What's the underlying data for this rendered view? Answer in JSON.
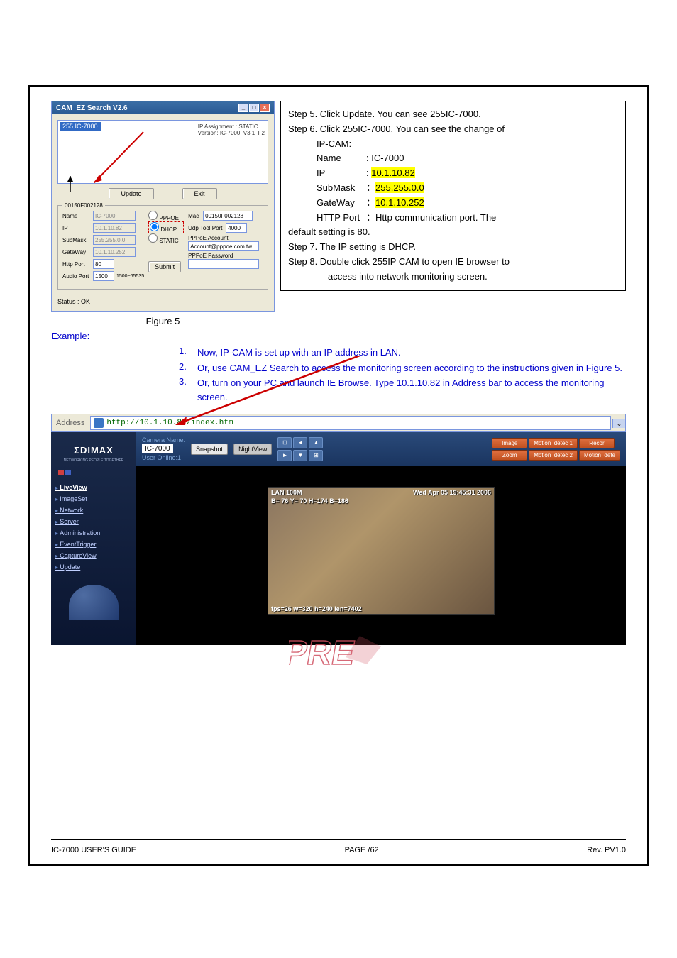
{
  "steps": {
    "s5": "Step 5. Click Update. You can see 255IC-7000.",
    "s6": "Step 6. Click 255IC-7000. You can see the change of",
    "s6b": "IP-CAM:",
    "name_lbl": "Name",
    "name_val": ": IC-7000",
    "ip_lbl": "IP",
    "ip_colon": ": ",
    "ip_val": "10.1.10.82",
    "sub_lbl": "SubMask",
    "sub_colon": "：",
    "sub_val": "255.255.0.0",
    "gw_lbl": "GateWay",
    "gw_colon": "：",
    "gw_val": "10.1.10.252",
    "http_lbl": "HTTP Port",
    "http_val": "：Http communication port. The",
    "default": "default setting is 80.",
    "s7": "Step 7. The IP setting is DHCP.",
    "s8": "Step 8. Double click 255IP CAM to open IE browser to",
    "s8b": "access into network monitoring screen."
  },
  "dialog": {
    "title": "CAM_EZ Search V2.6",
    "sel": "255 IC-7000",
    "ipassign": "IP Assignment : STATIC",
    "version": "Version: IC-7000_V3.1_F2",
    "update": "Update",
    "exit": "Exit",
    "legend": "00150F002128",
    "name": "Name",
    "name_v": "IC-7000",
    "ip": "IP",
    "ip_v": "10.1.10.82",
    "submask": "SubMask",
    "submask_v": "255.255.0.0",
    "gateway": "GateWay",
    "gateway_v": "10.1.10.252",
    "httpport": "Http Port",
    "httpport_v": "80",
    "audioport": "Audio Port",
    "audioport_v": "1500",
    "audioport_range": "1500~65535",
    "pppoe": "PPPOE",
    "dhcp": "DHCP",
    "static": "STATIC",
    "mac": "Mac",
    "mac_v": "00150F002128",
    "udp": "Udp Tool Port",
    "udp_v": "4000",
    "pppoe_acc": "PPPoE Account",
    "pppoe_acc_v": "Account@pppoe.com.tw",
    "pppoe_pwd": "PPPoE Password",
    "submit": "Submit",
    "status": "Status :    OK"
  },
  "figure": "Figure 5",
  "example_label": "Example:",
  "examples": {
    "n1": "1.",
    "t1": "Now, IP-CAM is set up with an IP address in LAN.",
    "n2": "2.",
    "t2": "Or, use CAM_EZ Search to access the monitoring screen according to the instructions given in Figure 5.",
    "n3": "3.",
    "t3": "Or, turn on your PC and launch IE Browse. Type 10.1.10.82 in Address bar to access the monitoring screen."
  },
  "browser": {
    "addr_lbl": "Address",
    "url": "http://10.1.10.82/index.htm",
    "logo": "ΣDIMAX",
    "logosub": "NETWORKING PEOPLE TOGETHER",
    "cam_name_lbl": "Camera Name:",
    "cam_name": "IC-7000",
    "user_online": "User Online:1",
    "snapshot": "Snapshot",
    "nightview": "NightView",
    "nav": {
      "liveview": "LiveView",
      "imageset": "ImageSet",
      "network": "Network",
      "server": "Server",
      "admin": "Administration",
      "event": "EventTrigger",
      "capture": "CaptureView",
      "update": "Update"
    },
    "rbtn": {
      "image": "Image",
      "zoom": "Zoom",
      "md1": "Motion_detec 1",
      "md2": "Motion_detec 2",
      "recor": "Recor",
      "mdete": "Motion_dete"
    },
    "overlay": {
      "lan": "LAN 100M",
      "date": "Wed Apr 05 19:45:31 2006",
      "coords": "B= 76 Y= 70 H=174 B=186",
      "fps": "fps=26 w=320 h=240 len=7402"
    }
  },
  "footer": {
    "left": "IC-7000 USER'S GUIDE",
    "center": "PAGE   /62",
    "right": "Rev. PV1.0"
  }
}
